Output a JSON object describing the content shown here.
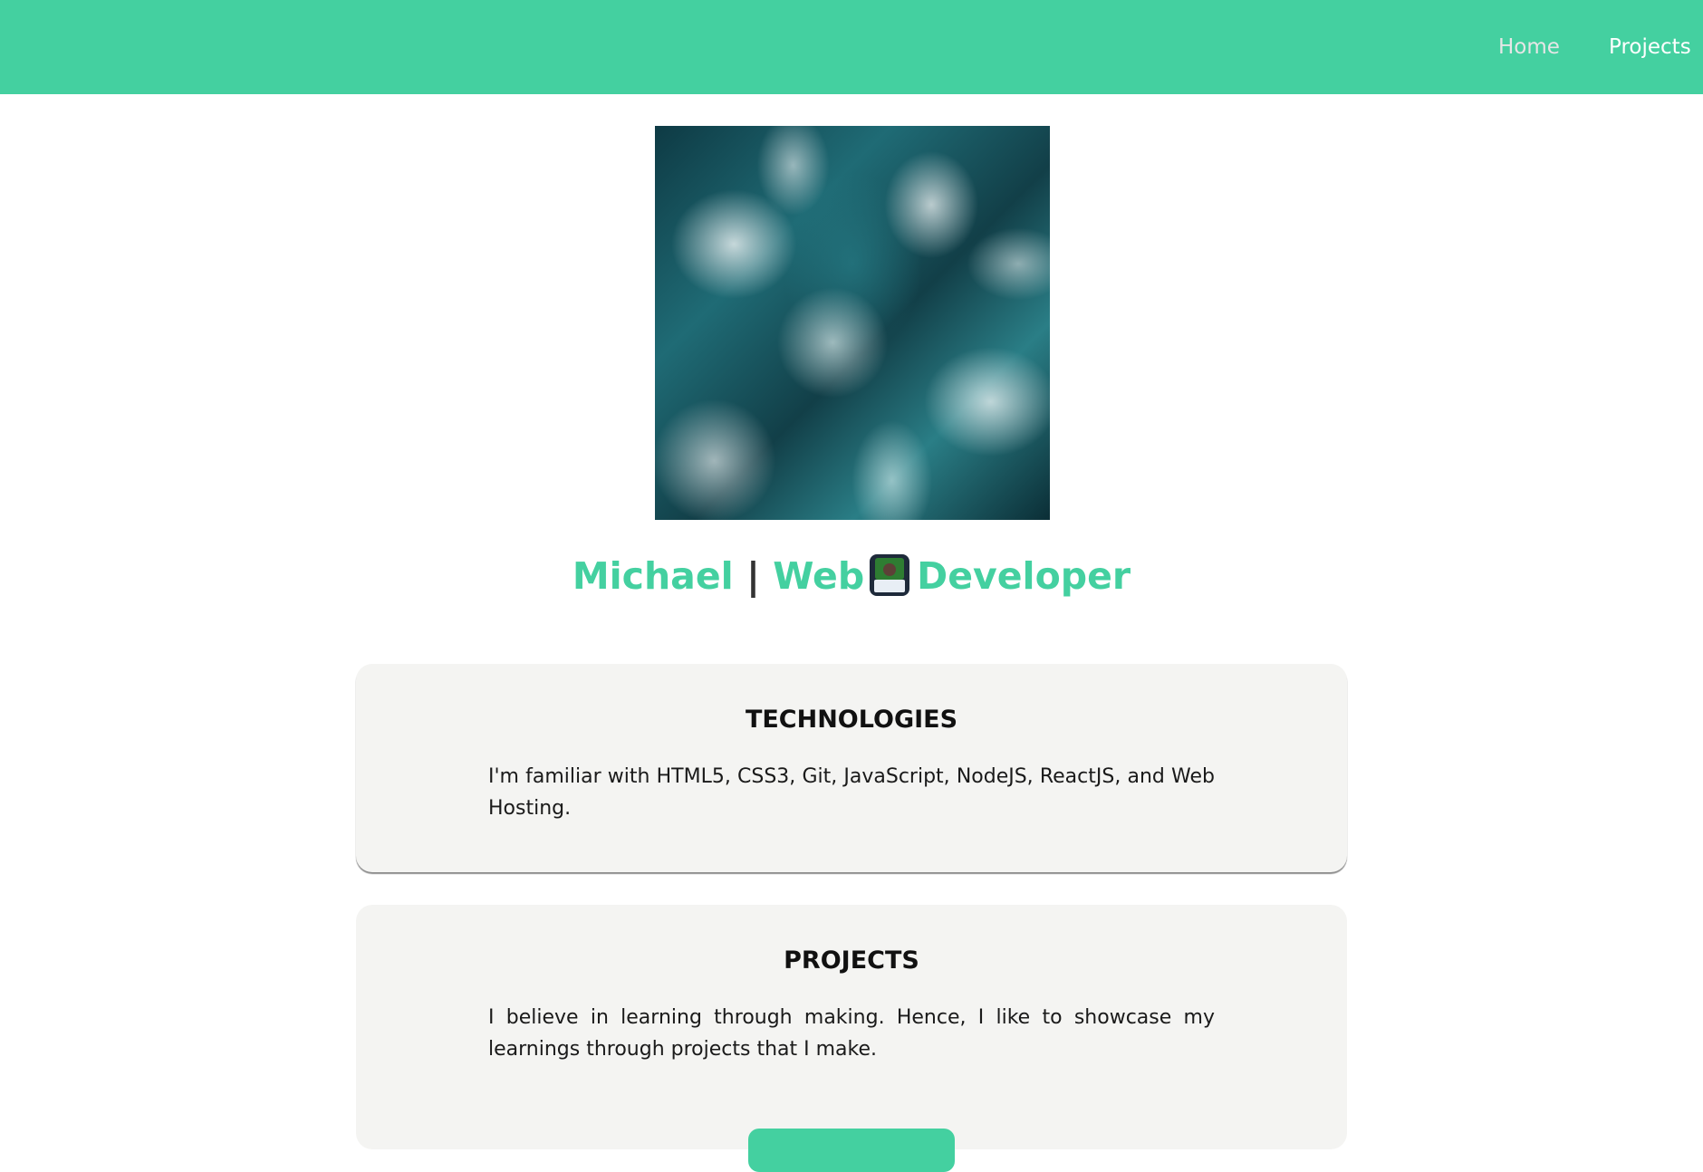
{
  "nav": {
    "home_label": "Home",
    "projects_label": "Projects"
  },
  "hero": {
    "name": "Michael",
    "separator": "|",
    "role_first": "Web",
    "role_second": "Developer",
    "icon": "technologist-emoji-icon"
  },
  "cards": {
    "technologies": {
      "heading": "TECHNOLOGIES",
      "text": "I'm familiar with HTML5, CSS3, Git, JavaScript, NodeJS, ReactJS, and Web Hosting."
    },
    "projects": {
      "heading": "PROJECTS",
      "text": "I believe in learning through making. Hence, I like to showcase my learnings through projects that I make."
    }
  },
  "colors": {
    "accent": "#44d0a0",
    "card_bg": "#f4f4f2",
    "text": "#1a1a1a"
  }
}
